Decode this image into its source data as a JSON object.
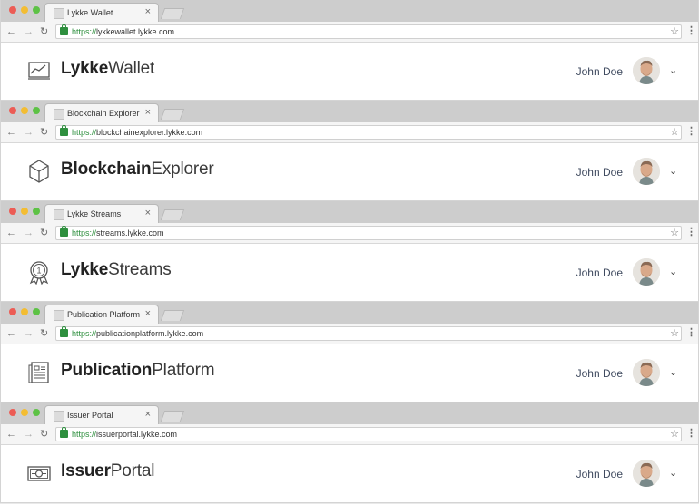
{
  "windows": [
    {
      "tab_title": "Lykke Wallet",
      "url_scheme": "https://",
      "url_host": "lykkewallet.lykke.com",
      "app_bold": "Lykke",
      "app_light": "Wallet",
      "icon": "chart-icon",
      "user": "John Doe"
    },
    {
      "tab_title": "Blockchain Explorer",
      "url_scheme": "https://",
      "url_host": "blockchainexplorer.lykke.com",
      "app_bold": "Blockchain",
      "app_light": "Explorer",
      "icon": "cube-icon",
      "user": "John Doe"
    },
    {
      "tab_title": "Lykke Streams",
      "url_scheme": "https://",
      "url_host": "streams.lykke.com",
      "app_bold": "Lykke",
      "app_light": "Streams",
      "icon": "medal-icon",
      "user": "John Doe"
    },
    {
      "tab_title": "Publication Platform",
      "url_scheme": "https://",
      "url_host": "publicationplatform.lykke.com",
      "app_bold": "Publication",
      "app_light": "Platform",
      "icon": "document-icon",
      "user": "John Doe"
    },
    {
      "tab_title": "Issuer Portal",
      "url_scheme": "https://",
      "url_host": "issuerportal.lykke.com",
      "app_bold": "Issuer",
      "app_light": "Portal",
      "icon": "banknote-icon",
      "user": "John Doe"
    }
  ],
  "glyphs": {
    "close": "×",
    "back": "←",
    "forward": "→",
    "reload": "↻",
    "star": "☆",
    "menu": "⋮",
    "chevron": "⌄"
  },
  "colors": {
    "tabbar": "#cdcdcd",
    "secure_green": "#2e8f3e",
    "user_text": "#3f4a5f"
  }
}
